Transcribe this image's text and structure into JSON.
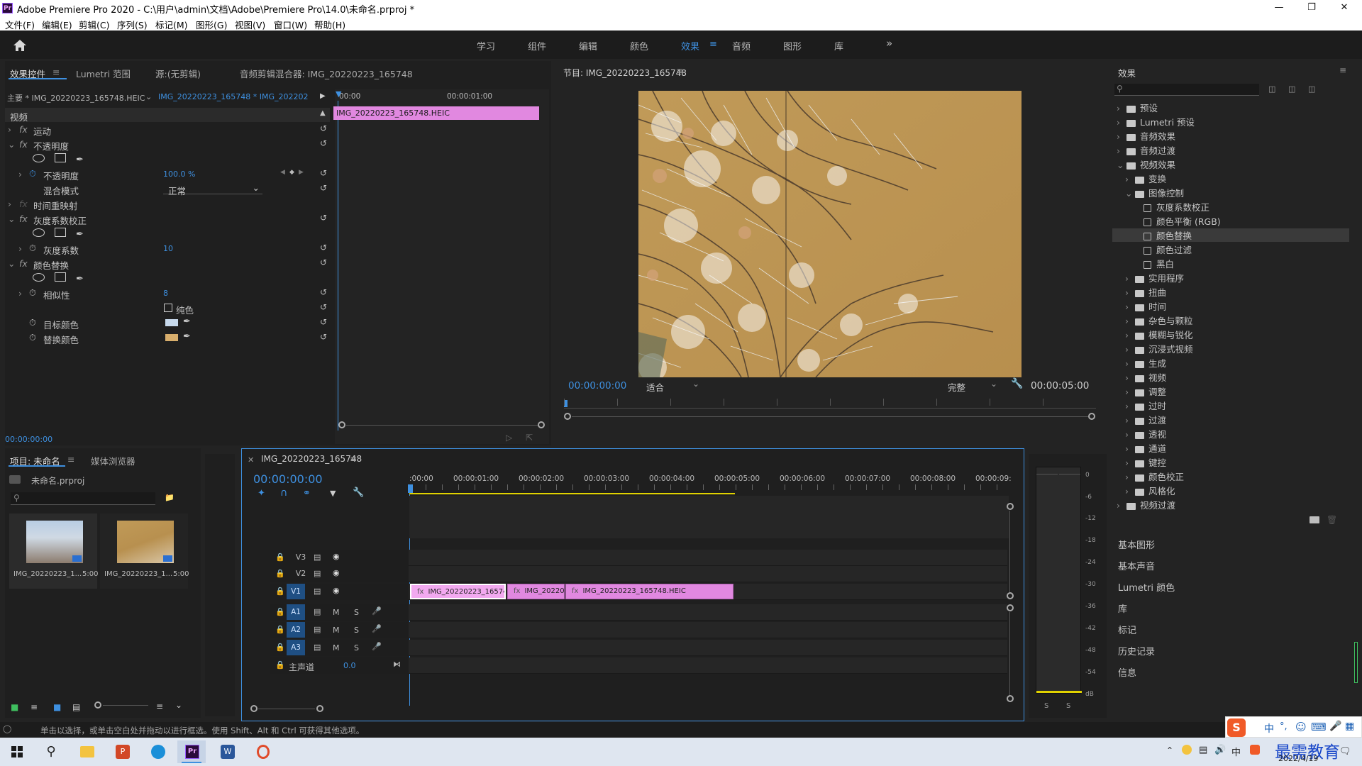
{
  "window": {
    "title": "Adobe Premiere Pro 2020 - C:\\用户\\admin\\文档\\Adobe\\Premiere Pro\\14.0\\未命名.prproj *",
    "app_icon": "Pr"
  },
  "menu": [
    "文件(F)",
    "编辑(E)",
    "剪辑(C)",
    "序列(S)",
    "标记(M)",
    "图形(G)",
    "视图(V)",
    "窗口(W)",
    "帮助(H)"
  ],
  "workspaces": [
    "学习",
    "组件",
    "编辑",
    "颜色",
    "效果",
    "音频",
    "图形",
    "库"
  ],
  "effect_controls": {
    "tabs": [
      "效果控件",
      "Lumetri 范围",
      "源:(无剪辑)",
      "音频剪辑混合器: IMG_20220223_165748"
    ],
    "master_label": "主要 * IMG_20220223_165748.HEIC",
    "sequence_label": "IMG_20220223_165748 * IMG_2022022...",
    "ruler_start": "00:00",
    "ruler_mark": "00:00:01:00",
    "clip_name": "IMG_20220223_165748.HEIC",
    "video_header": "视频",
    "motion": "运动",
    "opacity": "不透明度",
    "opacity_param": "不透明度",
    "opacity_value": "100.0 %",
    "blend_mode_label": "混合模式",
    "blend_mode_value": "正常",
    "time_remap": "时间重映射",
    "gamma_effect": "灰度系数校正",
    "gamma_param": "灰度系数",
    "gamma_value": "10",
    "color_replace_effect": "颜色替换",
    "similarity_param": "相似性",
    "similarity_value": "8",
    "solid_colors_label": "纯色",
    "target_color_label": "目标颜色",
    "replace_color_label": "替换颜色",
    "target_color": "#c7d9ec",
    "replace_color": "#d8ae6c",
    "timecode": "00:00:00:00"
  },
  "program_monitor": {
    "title": "节目: IMG_20220223_165748",
    "timecode": "00:00:00:00",
    "fit": "适合",
    "quality": "完整",
    "duration": "00:00:05:00"
  },
  "project": {
    "tabs": [
      "项目: 未命名",
      "媒体浏览器"
    ],
    "project_file": "未命名.prproj",
    "items": [
      {
        "name": "IMG_20220223_1...",
        "duration": "5:00"
      },
      {
        "name": "IMG_20220223_1...",
        "duration": "5:00"
      }
    ]
  },
  "timeline": {
    "tab": "IMG_20220223_165748",
    "timecode": "00:00:00:00",
    "ruler": [
      ":00:00",
      "00:00:01:00",
      "00:00:02:00",
      "00:00:03:00",
      "00:00:04:00",
      "00:00:05:00",
      "00:00:06:00",
      "00:00:07:00",
      "00:00:08:00",
      "00:00:09:"
    ],
    "video_tracks": [
      "V3",
      "V2",
      "V1"
    ],
    "audio_tracks": [
      "A1",
      "A2",
      "A3"
    ],
    "mute": "M",
    "solo": "S",
    "master_label": "主声道",
    "master_value": "0.0",
    "clips": [
      "IMG_20220223_165748.",
      "IMG_20220",
      "IMG_20220223_165748.HEIC"
    ]
  },
  "meter": {
    "labels": [
      "0",
      "-6",
      "-12",
      "-18",
      "-24",
      "-30",
      "-36",
      "-42",
      "-48",
      "-54",
      "dB"
    ],
    "solo": "S"
  },
  "effects_panel": {
    "title": "效果",
    "tree": [
      {
        "label": "预设",
        "level": 0,
        "type": "folder"
      },
      {
        "label": "Lumetri 预设",
        "level": 0,
        "type": "folder"
      },
      {
        "label": "音频效果",
        "level": 0,
        "type": "folder"
      },
      {
        "label": "音频过渡",
        "level": 0,
        "type": "folder"
      },
      {
        "label": "视频效果",
        "level": 0,
        "type": "folder",
        "open": true
      },
      {
        "label": "变换",
        "level": 1,
        "type": "folder"
      },
      {
        "label": "图像控制",
        "level": 1,
        "type": "folder",
        "open": true
      },
      {
        "label": "灰度系数校正",
        "level": 2,
        "type": "effect"
      },
      {
        "label": "颜色平衡 (RGB)",
        "level": 2,
        "type": "effect"
      },
      {
        "label": "颜色替换",
        "level": 2,
        "type": "effect",
        "selected": true
      },
      {
        "label": "颜色过滤",
        "level": 2,
        "type": "effect"
      },
      {
        "label": "黑白",
        "level": 2,
        "type": "effect"
      },
      {
        "label": "实用程序",
        "level": 1,
        "type": "folder"
      },
      {
        "label": "扭曲",
        "level": 1,
        "type": "folder"
      },
      {
        "label": "时间",
        "level": 1,
        "type": "folder"
      },
      {
        "label": "杂色与颗粒",
        "level": 1,
        "type": "folder"
      },
      {
        "label": "模糊与锐化",
        "level": 1,
        "type": "folder"
      },
      {
        "label": "沉浸式视频",
        "level": 1,
        "type": "folder"
      },
      {
        "label": "生成",
        "level": 1,
        "type": "folder"
      },
      {
        "label": "视频",
        "level": 1,
        "type": "folder"
      },
      {
        "label": "调整",
        "level": 1,
        "type": "folder"
      },
      {
        "label": "过时",
        "level": 1,
        "type": "folder"
      },
      {
        "label": "过渡",
        "level": 1,
        "type": "folder"
      },
      {
        "label": "透视",
        "level": 1,
        "type": "folder"
      },
      {
        "label": "通道",
        "level": 1,
        "type": "folder"
      },
      {
        "label": "键控",
        "level": 1,
        "type": "folder"
      },
      {
        "label": "颜色校正",
        "level": 1,
        "type": "folder"
      },
      {
        "label": "风格化",
        "level": 1,
        "type": "folder"
      },
      {
        "label": "视频过渡",
        "level": 0,
        "type": "folder"
      }
    ],
    "lower_panels": [
      "基本图形",
      "基本声音",
      "Lumetri 颜色",
      "库",
      "标记",
      "历史记录",
      "信息"
    ]
  },
  "status_bar": "单击以选择，或单击空白处并拖动以进行框选。使用 Shift、Alt 和 Ctrl 可获得其他选项。",
  "taskbar": {
    "date": "2022/4/19",
    "watermark": "最需教育"
  },
  "ime": {
    "items": [
      "中",
      "°,",
      "☺",
      "⌨"
    ]
  }
}
